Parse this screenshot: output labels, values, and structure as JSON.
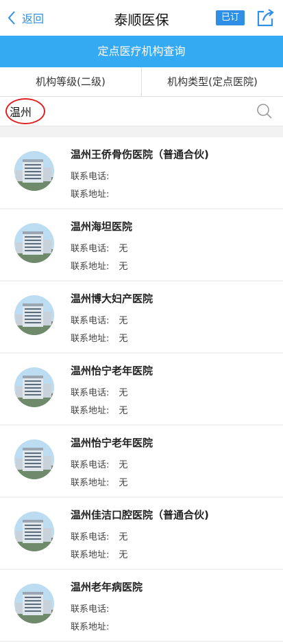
{
  "nav": {
    "back_label": "返回",
    "title": "泰顺医保",
    "badge": "已订"
  },
  "banner": {
    "title": "定点医疗机构查询"
  },
  "filters": [
    {
      "label": "机构等级(二级)"
    },
    {
      "label": "机构类型(定点医院)"
    }
  ],
  "search": {
    "value": "温州"
  },
  "labels": {
    "phone": "联系电话:",
    "address": "联系地址:"
  },
  "hospitals": [
    {
      "name": "温州王侨骨伤医院（普通合伙)",
      "phone": "",
      "address": ""
    },
    {
      "name": "温州海坦医院",
      "phone": "无",
      "address": "无"
    },
    {
      "name": "温州博大妇产医院",
      "phone": "无",
      "address": "无"
    },
    {
      "name": "温州怡宁老年医院",
      "phone": "无",
      "address": "无"
    },
    {
      "name": "温州怡宁老年医院",
      "phone": "无",
      "address": "无"
    },
    {
      "name": "温州佳洁口腔医院（普通合伙)",
      "phone": "无",
      "address": "无"
    },
    {
      "name": "温州老年病医院",
      "phone": "",
      "address": ""
    }
  ],
  "colors": {
    "accent": "#2f8ee6",
    "banner": "#33aaf2",
    "annotation": "#e02020"
  }
}
